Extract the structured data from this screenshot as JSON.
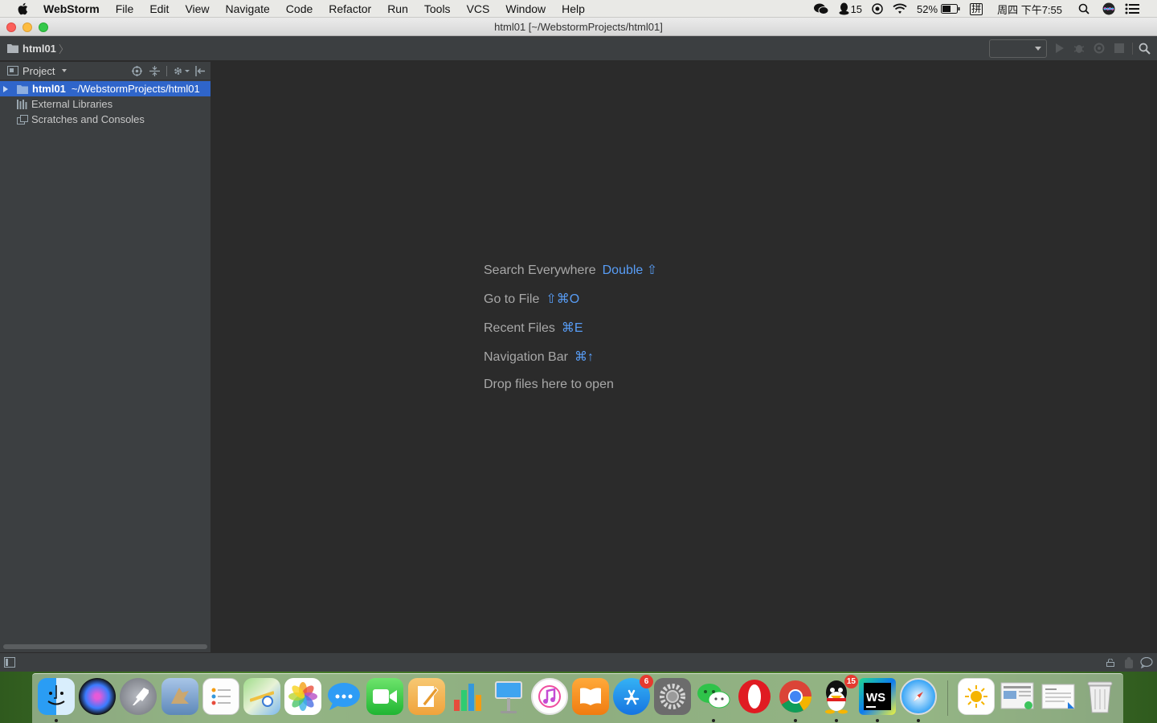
{
  "menubar": {
    "app_name": "WebStorm",
    "items": [
      "File",
      "Edit",
      "View",
      "Navigate",
      "Code",
      "Refactor",
      "Run",
      "Tools",
      "VCS",
      "Window",
      "Help"
    ],
    "qq_count": "15",
    "battery": "52%",
    "input_method": "拼",
    "clock": "周四 下午7:55"
  },
  "window": {
    "title": "html01 [~/WebstormProjects/html01]"
  },
  "navbar": {
    "breadcrumb": "html01"
  },
  "project_panel": {
    "title": "Project",
    "tree": [
      {
        "name": "html01",
        "path": "~/WebstormProjects/html01",
        "selected": true
      },
      {
        "name": "External Libraries"
      },
      {
        "name": "Scratches and Consoles"
      }
    ]
  },
  "editor": {
    "hints": [
      {
        "label": "Search Everywhere",
        "shortcut": "Double ⇧"
      },
      {
        "label": "Go to File",
        "shortcut": "⇧⌘O"
      },
      {
        "label": "Recent Files",
        "shortcut": "⌘E"
      },
      {
        "label": "Navigation Bar",
        "shortcut": "⌘↑"
      }
    ],
    "drop_text": "Drop files here to open"
  },
  "dock": {
    "app_store_badge": "6",
    "qq_badge": "15",
    "ws_label": "WS"
  },
  "colors": {
    "accent": "#589df6",
    "selection": "#2f65ca",
    "editor_bg": "#2b2b2b",
    "panel_bg": "#3c3f41"
  }
}
